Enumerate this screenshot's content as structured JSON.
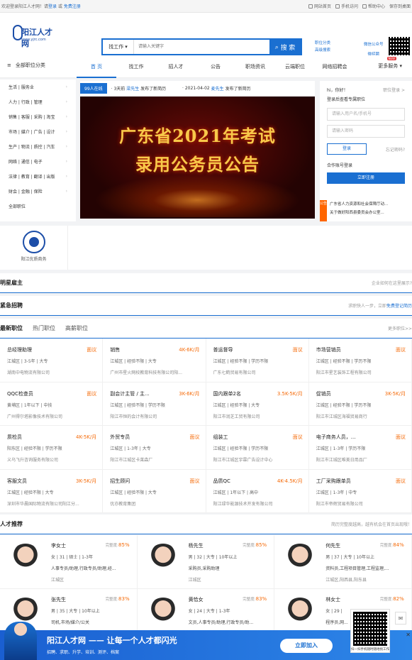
{
  "topbar": {
    "welcome": "欢迎登录阳江人才网！请",
    "login": "登录",
    "or": "或",
    "register": "免费注册",
    "links": [
      "网站首页",
      "手机访问",
      "帮助中心",
      "保存到桌面"
    ]
  },
  "header": {
    "logo_text": "阳江人才网",
    "logo_url": "www.yjrc.com",
    "search_select": "找工作",
    "search_placeholder": "请输入关键字",
    "search_button": "搜 索",
    "links1": [
      "职位分类",
      "高级搜索"
    ],
    "links2": [
      "微信公众号",
      "微招聘"
    ]
  },
  "nav": {
    "category": "全部职位分类",
    "items": [
      "首 页",
      "找工作",
      "招人才",
      "公告",
      "职场资讯",
      "云端职位",
      "网络招聘会"
    ],
    "more": "更多服务",
    "new_badge": "NEW"
  },
  "categories": [
    "生活 | 服务业",
    "人力 | 行政 | 管理",
    "销售 | 客服 | 采购 | 淘宝",
    "市场 | 媒介 | 广告 | 设计",
    "生产 | 物流 | 质控 | 汽车",
    "网络 | 通信 | 电子",
    "法律 | 教育 | 翻译 | 出版",
    "财会 | 金融 | 保险",
    "全部职位"
  ],
  "news": {
    "online": "99人在线",
    "items": [
      {
        "time": "· 3天前",
        "name": "梁先生",
        "action": "发布了新简历"
      },
      {
        "time": "· 2021-04-02",
        "name": "麦先生",
        "action": "发布了新简历"
      }
    ]
  },
  "banner": {
    "line1": "广东省2021年考试",
    "line2": "录用公务员公告"
  },
  "login": {
    "greeting": "hi，你好！",
    "quick": "职位登录 >",
    "hint": "登录后查看专属职位",
    "user_ph": "请输入用户名/手机号",
    "pass_ph": "请输入密码",
    "login_btn": "登录",
    "forgot": "忘记密码?",
    "partner": "合作账号登录",
    "reg_btn": "立即注册"
  },
  "notice": {
    "tag": "公告",
    "items": [
      "广东省人力资源和社会保障厅动...",
      "关于做好阳西县委员会办公室..."
    ]
  },
  "employer": {
    "name": "阳江优质商务"
  },
  "sections": {
    "famous": {
      "title": "明星雇主",
      "link": "企业如何在这里展示?"
    },
    "urgent": {
      "title": "紧急招聘",
      "note": "求职快人一步，立即",
      "link": "免费登记简历"
    },
    "latest": {
      "tabs": [
        "最新职位",
        "热门职位",
        "高薪职位"
      ],
      "more": "更多职位>>"
    },
    "talent": {
      "title": "人才推荐",
      "note": "简历完整度越高，越有机会在首页出现哦！"
    }
  },
  "jobs": [
    {
      "title": "总经理助理",
      "salary": "面议",
      "meta": "江城区 | 3-5年 | 大专",
      "company": "湖南中电物流有限公司"
    },
    {
      "title": "销售",
      "salary": "4K-6K/月",
      "meta": "江城区 | 经验不限 | 大专",
      "company": "广州市星火网校教育科技有限公司阳..."
    },
    {
      "title": "普运督导",
      "salary": "面议",
      "meta": "江城区 | 经验不限 | 学历不限",
      "company": "广东七鹤贸易有限公司"
    },
    {
      "title": "市场营销员",
      "salary": "面议",
      "meta": "江城区 | 经验不限 | 学历不限",
      "company": "阳江市星艺装饰工程有限公司"
    },
    {
      "title": "QQC检查员",
      "salary": "面议",
      "meta": "黄埔区 | 1年以下 | 中技",
      "company": "广州得尔塔影像技术有限公司"
    },
    {
      "title": "副会计主管 / 主...",
      "salary": "3K-6K/月",
      "meta": "江城区 | 经验不限 | 学历不限",
      "company": "阳江市恒的会计有限公司"
    },
    {
      "title": "国内跟单2名",
      "salary": "3.5K-5K/月",
      "meta": "江城区 | 经验不限 | 大专",
      "company": "阳江市润芝工贸有限公司"
    },
    {
      "title": "促销员",
      "salary": "3K-5K/月",
      "meta": "江城区 | 经验不限 | 学历不限",
      "company": "阳江市江城区海福贸易商行"
    },
    {
      "title": "质检员",
      "salary": "4K-5K/月",
      "meta": "阳东区 | 经验不限 | 学历不限",
      "company": "义乌飞升咨询服务有限公司"
    },
    {
      "title": "外贸专员",
      "salary": "面议",
      "meta": "江城区 | 1-3年 | 大专",
      "company": "阳江市江城区卡莱森厂"
    },
    {
      "title": "组装工",
      "salary": "面议",
      "meta": "江城区 | 经验不限 | 学历不限",
      "company": "阳江市江城区宇霖广告设计中心"
    },
    {
      "title": "电子商务人员，...",
      "salary": "面议",
      "meta": "江城区 | 1-3年 | 学历不限",
      "company": "阳江市江城区唯美日用品厂"
    },
    {
      "title": "客服文员",
      "salary": "3K-5K/月",
      "meta": "江城区 | 经验不限 | 大专",
      "company": "深圳市华晨国际物流有限公司阳江分..."
    },
    {
      "title": "招生顾问",
      "salary": "面议",
      "meta": "江城区 | 经验不限 | 大专",
      "company": "优亦教育集团"
    },
    {
      "title": "品质QC",
      "salary": "4K-4.5K/月",
      "meta": "江城区 | 1年以下 | 高中",
      "company": "阳江绿华能源技术开发有限公司"
    },
    {
      "title": "工厂采购跟单员",
      "salary": "面议",
      "meta": "江城区 | 1-3年 | 中专",
      "company": "阳江市帝辉贸易有限公司"
    }
  ],
  "talents": [
    {
      "name": "李女士",
      "pct_label": "完整度:",
      "pct": "85%",
      "info": "女 | 31 | 硕士 | 1-3年",
      "job": "人事专员/助理,行政专员/助理,经...",
      "area": "江城区"
    },
    {
      "name": "杨先生",
      "pct_label": "完整度:",
      "pct": "85%",
      "info": "男 | 32 | 大专 | 10年以上",
      "job": "采购员,采购助理",
      "area": "江城区"
    },
    {
      "name": "何先生",
      "pct_label": "完整度:",
      "pct": "84%",
      "info": "男 | 37 | 大专 | 10年以上",
      "job": "资料员,工程项目管理,工程监理,...",
      "area": "江城区,阳西县,阳东县"
    },
    {
      "name": "张先生",
      "pct_label": "完整度:",
      "pct": "83%",
      "info": "男 | 35 | 大专 | 10年以上",
      "job": "司机,市场/媒介/公关",
      "area": ""
    },
    {
      "name": "黄恰女",
      "pct_label": "完整度:",
      "pct": "83%",
      "info": "女 | 24 | 大专 | 1-3年",
      "job": "文员,人事专员/助理,行政专员/助...",
      "area": ""
    },
    {
      "name": "林女士",
      "pct_label": "完整度:",
      "pct": "82%",
      "info": "女 | 29 |",
      "job": "程序员,网...",
      "area": ""
    }
  ],
  "bottom": {
    "title": "阳江人才网 —— 让每一个人才都闪光",
    "sub": "招聘、求职、升学、培训、测评、档案",
    "button": "立即加入",
    "qr_label": "扫一扫手机随时随地找工作",
    "close": "✕"
  }
}
